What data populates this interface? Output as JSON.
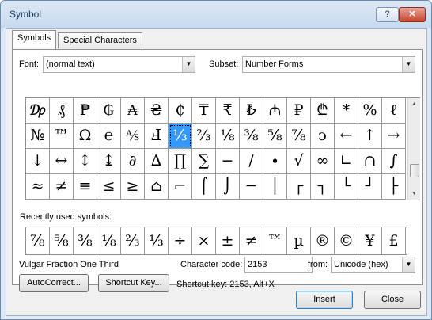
{
  "window": {
    "title": "Symbol",
    "help_label": "?",
    "close_label": "✕"
  },
  "tabs": [
    {
      "label": "Symbols"
    },
    {
      "label": "Special Characters"
    }
  ],
  "font": {
    "label": "Font:",
    "value": "(normal text)"
  },
  "subset": {
    "label": "Subset:",
    "value": "Number Forms"
  },
  "symbol_grid": {
    "rows": [
      [
        "₯",
        "₰",
        "₱",
        "₲",
        "₳",
        "₴",
        "₵",
        "₸",
        "₹",
        "₺",
        "₼",
        "₽",
        "₾",
        "*",
        "%",
        "ℓ"
      ],
      [
        "№",
        "™",
        "Ω",
        "℮",
        "⅍",
        "Ⅎ",
        "⅓",
        "⅔",
        "⅛",
        "⅜",
        "⅝",
        "⅞",
        "ↄ",
        "←",
        "↑",
        "→"
      ],
      [
        "↓",
        "↔",
        "↕",
        "↨",
        "∂",
        "∆",
        "∏",
        "∑",
        "−",
        "∕",
        "∙",
        "√",
        "∞",
        "∟",
        "∩",
        "∫"
      ],
      [
        "≈",
        "≠",
        "≡",
        "≤",
        "≥",
        "⌂",
        "⌐",
        "⌠",
        "⌡",
        "─",
        "│",
        "┌",
        "┐",
        "└",
        "┘",
        "├"
      ]
    ],
    "selected_symbol": "⅓"
  },
  "recently_used": {
    "label": "Recently used symbols:",
    "symbols": [
      "⅞",
      "⅝",
      "⅜",
      "⅛",
      "⅔",
      "⅓",
      "÷",
      "×",
      "±",
      "≠",
      "™",
      "µ",
      "®",
      "©",
      "¥",
      "£"
    ]
  },
  "character": {
    "name": "Vulgar Fraction One Third",
    "code_label": "Character code:",
    "code_value": "2153",
    "from_label": "from:",
    "from_value": "Unicode (hex)"
  },
  "buttons": {
    "autocorrect": "AutoCorrect...",
    "shortcut_key": "Shortcut Key...",
    "insert": "Insert",
    "close": "Close"
  },
  "shortcut_text": "Shortcut key: 2153, Alt+X"
}
